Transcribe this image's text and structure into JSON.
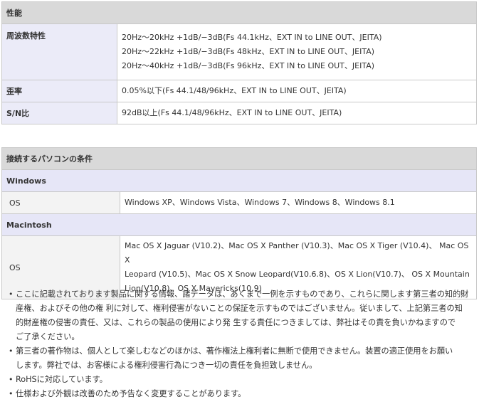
{
  "performance": {
    "header": "性能",
    "rows": [
      {
        "label": "周波数特性",
        "lines": [
          "20Hz～20kHz +1dB/−3dB(Fs 44.1kHz、EXT IN to LINE OUT、JEITA)",
          "20Hz～22kHz +1dB/−3dB(Fs 48kHz、EXT IN to LINE OUT、JEITA)",
          "20Hz～40kHz +1dB/−3dB(Fs 96kHz、EXT IN to LINE OUT、JEITA)"
        ]
      },
      {
        "label": "歪率",
        "lines": [
          "0.05%以下(Fs 44.1/48/96kHz、EXT IN to LINE OUT、JEITA)"
        ]
      },
      {
        "label": "S/N比",
        "lines": [
          "92dB以上(Fs 44.1/48/96kHz、EXT IN to LINE OUT、JEITA)"
        ]
      }
    ]
  },
  "pc_requirements": {
    "header": "接続するパソコンの条件",
    "windows": {
      "title": "Windows",
      "label": "OS",
      "value": "Windows XP、Windows Vista、Windows 7、Windows 8、Windows 8.1"
    },
    "macintosh": {
      "title": "Macintosh",
      "label": "OS",
      "lines": [
        "Mac OS X Jaguar (V10.2)、Mac OS X Panther (V10.3)、Mac OS X Tiger (V10.4)、 Mac OS X",
        "Leopard (V10.5)、Mac OS X Snow Leopard(V10.6.8)、OS X Lion(V10.7)、 OS X Mountain",
        "Lion(V10.8)、OS X Mavericks(10.9)"
      ]
    }
  },
  "notes": [
    {
      "lines": [
        "ここに記載されております製品に関する情報、諸データは、あくまで一例を示すものであり、これらに関します第三者の知的財",
        "産権、およびその他の権 利に対して、権利侵害がないことの保証を示すものではございません。従いまして、上記第三者の知",
        "的財産権の侵害の責任、又は、これらの製品の使用により発 生する責任につきましては、弊社はその責を負いかねますので",
        "ご了承ください。"
      ]
    },
    {
      "lines": [
        "第三者の著作物は、個人として楽しむなどのほかは、著作権法上権利者に無断で使用できません。装置の適正使用をお願い",
        "します。弊社では、お客様による権利侵害行為につき一切の責任を負担致しません。"
      ]
    },
    {
      "lines": [
        "RoHSに対応しています。"
      ]
    },
    {
      "lines": [
        "仕様および外観は改善のため予告なく変更することがあります。"
      ]
    }
  ]
}
